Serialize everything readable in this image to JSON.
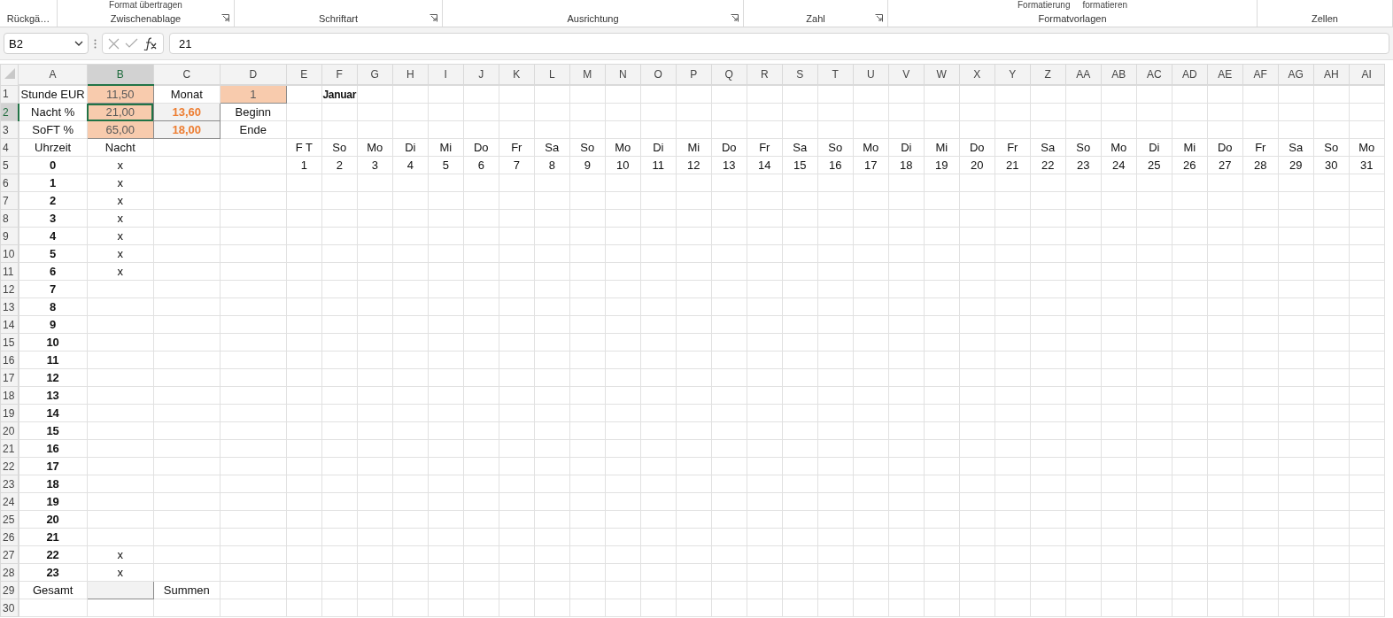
{
  "ribbon": {
    "groups": [
      {
        "label": "Rückgä…",
        "launcher": false
      },
      {
        "label": "Zwischenablage",
        "launcher": true,
        "items": [
          "Format übertragen"
        ]
      },
      {
        "label": "Schriftart",
        "launcher": true
      },
      {
        "label": "Ausrichtung",
        "launcher": true
      },
      {
        "label": "Zahl",
        "launcher": true
      },
      {
        "label": "Formatvorlagen",
        "launcher": false,
        "items": [
          "Formatierung",
          "formatieren"
        ]
      },
      {
        "label": "Zellen",
        "launcher": false
      }
    ]
  },
  "formula_bar": {
    "name_box": "B2",
    "formula": "21"
  },
  "sheet": {
    "columns": [
      {
        "label": "A",
        "selected": false
      },
      {
        "label": "B",
        "selected": true
      },
      {
        "label": "C",
        "selected": false
      },
      {
        "label": "D",
        "selected": false
      },
      {
        "label": "E",
        "selected": false
      },
      {
        "label": "F",
        "selected": false
      },
      {
        "label": "G",
        "selected": false
      },
      {
        "label": "H",
        "selected": false
      },
      {
        "label": "I",
        "selected": false
      },
      {
        "label": "J",
        "selected": false
      },
      {
        "label": "K",
        "selected": false
      },
      {
        "label": "L",
        "selected": false
      },
      {
        "label": "M",
        "selected": false
      },
      {
        "label": "N",
        "selected": false
      },
      {
        "label": "O",
        "selected": false
      },
      {
        "label": "P",
        "selected": false
      },
      {
        "label": "Q",
        "selected": false
      },
      {
        "label": "R",
        "selected": false
      },
      {
        "label": "S",
        "selected": false
      },
      {
        "label": "T",
        "selected": false
      },
      {
        "label": "U",
        "selected": false
      },
      {
        "label": "V",
        "selected": false
      },
      {
        "label": "W",
        "selected": false
      },
      {
        "label": "X",
        "selected": false
      },
      {
        "label": "Y",
        "selected": false
      },
      {
        "label": "Z",
        "selected": false
      },
      {
        "label": "AA",
        "selected": false
      },
      {
        "label": "AB",
        "selected": false
      },
      {
        "label": "AC",
        "selected": false
      },
      {
        "label": "AD",
        "selected": false
      },
      {
        "label": "AE",
        "selected": false
      },
      {
        "label": "AF",
        "selected": false
      },
      {
        "label": "AG",
        "selected": false
      },
      {
        "label": "AH",
        "selected": false
      },
      {
        "label": "AI",
        "selected": false
      }
    ],
    "rows": [
      {
        "label": "1",
        "selected": false,
        "cells": [
          {
            "text": "Stunde EUR",
            "kind": "plain",
            "selected": false
          },
          {
            "text": "11,50",
            "kind": "input",
            "selected": false
          },
          {
            "text": "Monat",
            "kind": "plain",
            "selected": false
          },
          {
            "text": "1",
            "kind": "input",
            "selected": false
          },
          {
            "kind": "empty",
            "selected": false
          },
          {
            "text": "Januar",
            "kind": "title",
            "selected": false
          }
        ]
      },
      {
        "label": "2",
        "selected": true,
        "cells": [
          {
            "text": "Nacht %",
            "kind": "plain",
            "selected": false
          },
          {
            "text": "21,00",
            "kind": "input",
            "selected": true
          },
          {
            "text": "13,60",
            "kind": "result",
            "selected": false
          },
          {
            "text": "Beginn",
            "kind": "plain",
            "selected": false
          }
        ]
      },
      {
        "label": "3",
        "selected": false,
        "cells": [
          {
            "text": "SoFT %",
            "kind": "plain",
            "selected": false
          },
          {
            "text": "65,00",
            "kind": "input",
            "selected": false
          },
          {
            "text": "18,00",
            "kind": "result",
            "selected": false
          },
          {
            "text": "Ende",
            "kind": "plain",
            "selected": false
          }
        ]
      },
      {
        "label": "4",
        "selected": false,
        "cells": [
          {
            "text": "Uhrzeit",
            "kind": "plain",
            "selected": false
          },
          {
            "text": "Nacht",
            "kind": "plain",
            "selected": false
          },
          {
            "kind": "empty",
            "selected": false
          },
          {
            "kind": "empty",
            "selected": false
          },
          {
            "text": "F T",
            "kind": "plain",
            "selected": false
          },
          {
            "text": "So",
            "kind": "plain",
            "selected": false
          },
          {
            "text": "Mo",
            "kind": "plain",
            "selected": false
          },
          {
            "text": "Di",
            "kind": "plain",
            "selected": false
          },
          {
            "text": "Mi",
            "kind": "plain",
            "selected": false
          },
          {
            "text": "Do",
            "kind": "plain",
            "selected": false
          },
          {
            "text": "Fr",
            "kind": "plain",
            "selected": false
          },
          {
            "text": "Sa",
            "kind": "plain",
            "selected": false
          },
          {
            "text": "So",
            "kind": "plain",
            "selected": false
          },
          {
            "text": "Mo",
            "kind": "plain",
            "selected": false
          },
          {
            "text": "Di",
            "kind": "plain",
            "selected": false
          },
          {
            "text": "Mi",
            "kind": "plain",
            "selected": false
          },
          {
            "text": "Do",
            "kind": "plain",
            "selected": false
          },
          {
            "text": "Fr",
            "kind": "plain",
            "selected": false
          },
          {
            "text": "Sa",
            "kind": "plain",
            "selected": false
          },
          {
            "text": "So",
            "kind": "plain",
            "selected": false
          },
          {
            "text": "Mo",
            "kind": "plain",
            "selected": false
          },
          {
            "text": "Di",
            "kind": "plain",
            "selected": false
          },
          {
            "text": "Mi",
            "kind": "plain",
            "selected": false
          },
          {
            "text": "Do",
            "kind": "plain",
            "selected": false
          },
          {
            "text": "Fr",
            "kind": "plain",
            "selected": false
          },
          {
            "text": "Sa",
            "kind": "plain",
            "selected": false
          },
          {
            "text": "So",
            "kind": "plain",
            "selected": false
          },
          {
            "text": "Mo",
            "kind": "plain",
            "selected": false
          },
          {
            "text": "Di",
            "kind": "plain",
            "selected": false
          },
          {
            "text": "Mi",
            "kind": "plain",
            "selected": false
          },
          {
            "text": "Do",
            "kind": "plain",
            "selected": false
          },
          {
            "text": "Fr",
            "kind": "plain",
            "selected": false
          },
          {
            "text": "Sa",
            "kind": "plain",
            "selected": false
          },
          {
            "text": "So",
            "kind": "plain",
            "selected": false
          },
          {
            "text": "Mo",
            "kind": "plain",
            "selected": false
          }
        ]
      },
      {
        "label": "5",
        "selected": false,
        "cells": [
          {
            "text": "0",
            "kind": "bold",
            "selected": false
          },
          {
            "text": "x",
            "kind": "plain",
            "selected": false
          },
          {
            "kind": "empty",
            "selected": false
          },
          {
            "kind": "empty",
            "selected": false
          },
          {
            "text": "1",
            "kind": "plain",
            "selected": false
          },
          {
            "text": "2",
            "kind": "plain",
            "selected": false
          },
          {
            "text": "3",
            "kind": "plain",
            "selected": false
          },
          {
            "text": "4",
            "kind": "plain",
            "selected": false
          },
          {
            "text": "5",
            "kind": "plain",
            "selected": false
          },
          {
            "text": "6",
            "kind": "plain",
            "selected": false
          },
          {
            "text": "7",
            "kind": "plain",
            "selected": false
          },
          {
            "text": "8",
            "kind": "plain",
            "selected": false
          },
          {
            "text": "9",
            "kind": "plain",
            "selected": false
          },
          {
            "text": "10",
            "kind": "plain",
            "selected": false
          },
          {
            "text": "11",
            "kind": "plain",
            "selected": false
          },
          {
            "text": "12",
            "kind": "plain",
            "selected": false
          },
          {
            "text": "13",
            "kind": "plain",
            "selected": false
          },
          {
            "text": "14",
            "kind": "plain",
            "selected": false
          },
          {
            "text": "15",
            "kind": "plain",
            "selected": false
          },
          {
            "text": "16",
            "kind": "plain",
            "selected": false
          },
          {
            "text": "17",
            "kind": "plain",
            "selected": false
          },
          {
            "text": "18",
            "kind": "plain",
            "selected": false
          },
          {
            "text": "19",
            "kind": "plain",
            "selected": false
          },
          {
            "text": "20",
            "kind": "plain",
            "selected": false
          },
          {
            "text": "21",
            "kind": "plain",
            "selected": false
          },
          {
            "text": "22",
            "kind": "plain",
            "selected": false
          },
          {
            "text": "23",
            "kind": "plain",
            "selected": false
          },
          {
            "text": "24",
            "kind": "plain",
            "selected": false
          },
          {
            "text": "25",
            "kind": "plain",
            "selected": false
          },
          {
            "text": "26",
            "kind": "plain",
            "selected": false
          },
          {
            "text": "27",
            "kind": "plain",
            "selected": false
          },
          {
            "text": "28",
            "kind": "plain",
            "selected": false
          },
          {
            "text": "29",
            "kind": "plain",
            "selected": false
          },
          {
            "text": "30",
            "kind": "plain",
            "selected": false
          },
          {
            "text": "31",
            "kind": "plain",
            "selected": false
          }
        ]
      },
      {
        "label": "6",
        "selected": false,
        "cells": [
          {
            "text": "1",
            "kind": "bold",
            "selected": false
          },
          {
            "text": "x",
            "kind": "plain",
            "selected": false
          }
        ]
      },
      {
        "label": "7",
        "selected": false,
        "cells": [
          {
            "text": "2",
            "kind": "bold",
            "selected": false
          },
          {
            "text": "x",
            "kind": "plain",
            "selected": false
          }
        ]
      },
      {
        "label": "8",
        "selected": false,
        "cells": [
          {
            "text": "3",
            "kind": "bold",
            "selected": false
          },
          {
            "text": "x",
            "kind": "plain",
            "selected": false
          }
        ]
      },
      {
        "label": "9",
        "selected": false,
        "cells": [
          {
            "text": "4",
            "kind": "bold",
            "selected": false
          },
          {
            "text": "x",
            "kind": "plain",
            "selected": false
          }
        ]
      },
      {
        "label": "10",
        "selected": false,
        "cells": [
          {
            "text": "5",
            "kind": "bold",
            "selected": false
          },
          {
            "text": "x",
            "kind": "plain",
            "selected": false
          }
        ]
      },
      {
        "label": "11",
        "selected": false,
        "cells": [
          {
            "text": "6",
            "kind": "bold",
            "selected": false
          },
          {
            "text": "x",
            "kind": "plain",
            "selected": false
          }
        ]
      },
      {
        "label": "12",
        "selected": false,
        "cells": [
          {
            "text": "7",
            "kind": "bold",
            "selected": false
          }
        ]
      },
      {
        "label": "13",
        "selected": false,
        "cells": [
          {
            "text": "8",
            "kind": "bold",
            "selected": false
          }
        ]
      },
      {
        "label": "14",
        "selected": false,
        "cells": [
          {
            "text": "9",
            "kind": "bold",
            "selected": false
          }
        ]
      },
      {
        "label": "15",
        "selected": false,
        "cells": [
          {
            "text": "10",
            "kind": "bold",
            "selected": false
          }
        ]
      },
      {
        "label": "16",
        "selected": false,
        "cells": [
          {
            "text": "11",
            "kind": "bold",
            "selected": false
          }
        ]
      },
      {
        "label": "17",
        "selected": false,
        "cells": [
          {
            "text": "12",
            "kind": "bold",
            "selected": false
          }
        ]
      },
      {
        "label": "18",
        "selected": false,
        "cells": [
          {
            "text": "13",
            "kind": "bold",
            "selected": false
          }
        ]
      },
      {
        "label": "19",
        "selected": false,
        "cells": [
          {
            "text": "14",
            "kind": "bold",
            "selected": false
          }
        ]
      },
      {
        "label": "20",
        "selected": false,
        "cells": [
          {
            "text": "15",
            "kind": "bold",
            "selected": false
          }
        ]
      },
      {
        "label": "21",
        "selected": false,
        "cells": [
          {
            "text": "16",
            "kind": "bold",
            "selected": false
          }
        ]
      },
      {
        "label": "22",
        "selected": false,
        "cells": [
          {
            "text": "17",
            "kind": "bold",
            "selected": false
          }
        ]
      },
      {
        "label": "23",
        "selected": false,
        "cells": [
          {
            "text": "18",
            "kind": "bold",
            "selected": false
          }
        ]
      },
      {
        "label": "24",
        "selected": false,
        "cells": [
          {
            "text": "19",
            "kind": "bold",
            "selected": false
          }
        ]
      },
      {
        "label": "25",
        "selected": false,
        "cells": [
          {
            "text": "20",
            "kind": "bold",
            "selected": false
          }
        ]
      },
      {
        "label": "26",
        "selected": false,
        "cells": [
          {
            "text": "21",
            "kind": "bold",
            "selected": false
          }
        ]
      },
      {
        "label": "27",
        "selected": false,
        "cells": [
          {
            "text": "22",
            "kind": "bold",
            "selected": false
          },
          {
            "text": "x",
            "kind": "plain",
            "selected": false
          }
        ]
      },
      {
        "label": "28",
        "selected": false,
        "cells": [
          {
            "text": "23",
            "kind": "bold",
            "selected": false
          },
          {
            "text": "x",
            "kind": "plain",
            "selected": false
          }
        ]
      },
      {
        "label": "29",
        "selected": false,
        "cells": [
          {
            "text": "Gesamt",
            "kind": "plain",
            "selected": false
          },
          {
            "kind": "total",
            "selected": false
          },
          {
            "text": "Summen",
            "kind": "plain",
            "selected": false
          }
        ]
      },
      {
        "label": "30",
        "selected": false,
        "cells": []
      }
    ]
  }
}
